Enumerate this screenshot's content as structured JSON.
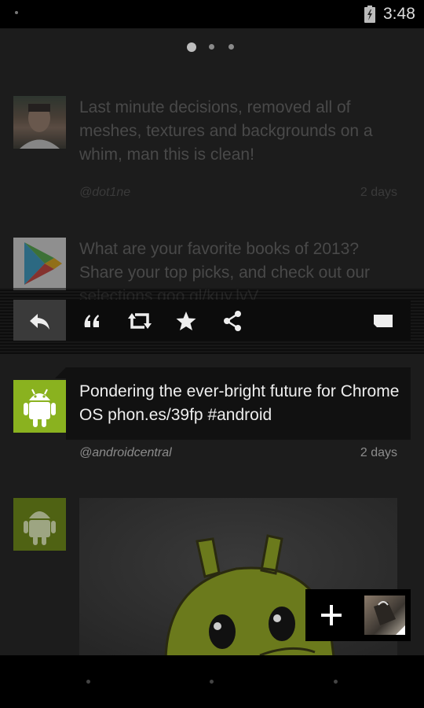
{
  "status_bar": {
    "time": "3:48"
  },
  "pager": {
    "pages": 3,
    "active": 0
  },
  "tweets": [
    {
      "text": "Last minute decisions, removed all of meshes, textures and backgrounds on a whim, man this is clean!",
      "handle": "@dot1ne",
      "time": "2 days"
    },
    {
      "text": "What are your favorite books of 2013? Share your top picks, and check out our selections goo.gl/kuy.lyV",
      "handle": "",
      "time": ""
    },
    {
      "text": "Pondering the ever-bright future for Chrome OS phon.es/39fp #android",
      "handle": "@androidcentral",
      "time": "2 days"
    }
  ],
  "action_bar": {
    "icons": [
      "reply-icon",
      "quote-icon",
      "retweet-icon",
      "favorite-icon",
      "share-icon",
      "more-icon"
    ]
  },
  "fab": {
    "icon": "plus-icon"
  },
  "colors": {
    "background": "#1c1c1c",
    "android_green": "#8ab21f",
    "bar": "#000000"
  }
}
